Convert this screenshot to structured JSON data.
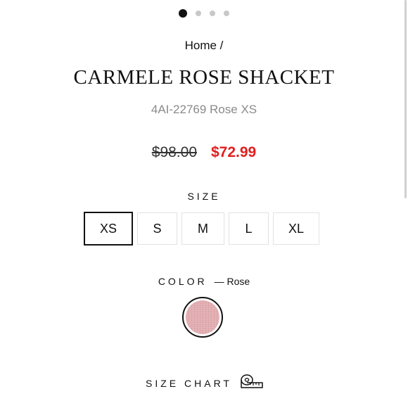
{
  "carousel": {
    "dots": 4,
    "active_index": 0
  },
  "breadcrumb": {
    "home_label": "Home /"
  },
  "product": {
    "title": "CARMELE ROSE SHACKET",
    "sku_line": "4AI-22769 Rose XS",
    "original_price": "$98.00",
    "sale_price": "$72.99"
  },
  "size_selector": {
    "label": "SIZE",
    "options": [
      "XS",
      "S",
      "M",
      "L",
      "XL"
    ],
    "selected": "XS"
  },
  "color_selector": {
    "label": "COLOR",
    "value": "— Rose",
    "swatch_color": "#e3aeb2"
  },
  "size_chart": {
    "label": "SIZE CHART",
    "icon": "measuring-tape-icon"
  },
  "colors": {
    "sale": "#e01e1e",
    "muted": "#8a8a8a",
    "text": "#111111"
  }
}
